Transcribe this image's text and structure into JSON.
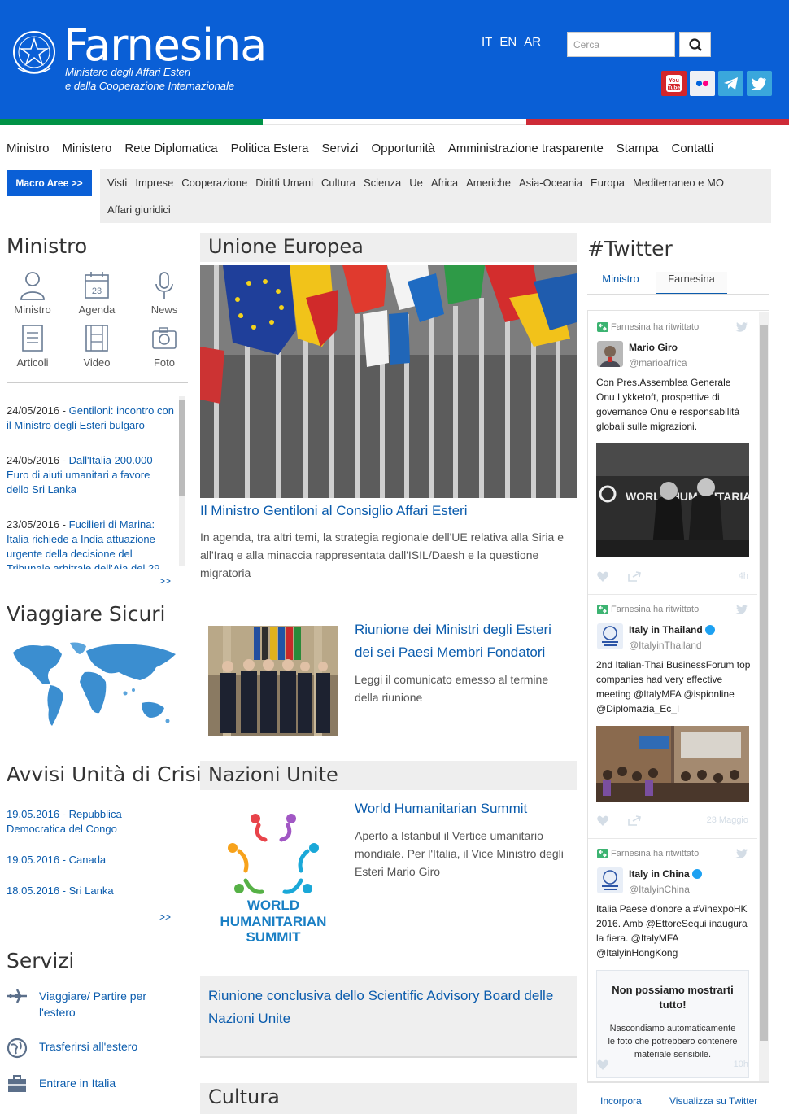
{
  "header": {
    "brand": "Farnesina",
    "subtitle_line1": "Ministero degli Affari Esteri",
    "subtitle_line2": "e della Cooperazione Internazionale",
    "langs": [
      "IT",
      "EN",
      "AR"
    ],
    "search_placeholder": "Cerca",
    "social": [
      "youtube-icon",
      "flickr-icon",
      "telegram-icon",
      "twitter-icon"
    ],
    "colors": {
      "brand_blue": "#0a5fd6",
      "flag_green": "#009246",
      "flag_white": "#ffffff",
      "flag_red": "#ce2b37"
    }
  },
  "nav": {
    "items": [
      "Ministro",
      "Ministero",
      "Rete Diplomatica",
      "Politica Estera",
      "Servizi",
      "Opportunità",
      "Amministrazione trasparente",
      "Stampa",
      "Contatti"
    ],
    "macro_label": "Macro Aree >>",
    "sub_items": [
      "Visti",
      "Imprese",
      "Cooperazione",
      "Diritti Umani",
      "Cultura",
      "Scienza",
      "Ue",
      "Africa",
      "Americhe",
      "Asia-Oceania",
      "Europa",
      "Mediterraneo e MO",
      "Affari giuridici"
    ]
  },
  "left": {
    "ministro_title": "Ministro",
    "icons": [
      {
        "label": "Ministro",
        "icon": "person-icon"
      },
      {
        "label": "Agenda",
        "icon": "calendar-icon",
        "day": "23"
      },
      {
        "label": "News",
        "icon": "microphone-icon"
      },
      {
        "label": "Articoli",
        "icon": "document-icon"
      },
      {
        "label": "Video",
        "icon": "film-icon"
      },
      {
        "label": "Foto",
        "icon": "camera-icon"
      }
    ],
    "news": [
      {
        "date": "24/05/2016 - ",
        "text": "Gentiloni: incontro con il Ministro degli Esteri bulgaro"
      },
      {
        "date": "24/05/2016 - ",
        "text": "Dall'Italia 200.000 Euro di aiuti umanitari a favore dello Sri Lanka"
      },
      {
        "date": "23/05/2016 - ",
        "text": "Fucilieri di Marina: Italia richiede a India attuazione urgente della decisione del Tribunale arbitrale dell'Aja del 29"
      }
    ],
    "more": ">>",
    "viaggiare_title": "Viaggiare Sicuri",
    "avvisi_title": "Avvisi Unità di Crisi",
    "avvisi": [
      {
        "date": "19.05.2016 - ",
        "text": "Repubblica Democratica del Congo"
      },
      {
        "date": "19.05.2016 - ",
        "text": "Canada"
      },
      {
        "date": "18.05.2016 - ",
        "text": "Sri Lanka"
      }
    ],
    "avvisi_more": ">>",
    "servizi_title": "Servizi",
    "servizi": [
      {
        "label": "Viaggiare/ Partire per l'estero",
        "icon": "plane-icon"
      },
      {
        "label": "Trasferirsi all'estero",
        "icon": "globe-icon"
      },
      {
        "label": "Entrare in Italia",
        "icon": "briefcase-icon"
      }
    ]
  },
  "center": {
    "ue_title": "Unione Europea",
    "ue_article_title": "Il Ministro Gentiloni al Consiglio Affari Esteri",
    "ue_article_text": "In agenda, tra altri temi, la strategia regionale dell'UE relativa alla Siria e all'Iraq e alla minaccia rappresentata dall'ISIL/Daesh e la questione migratoria",
    "riunione_title": "Riunione dei Ministri degli Esteri dei sei Paesi Membri Fondatori",
    "riunione_text": "Leggi il comunicato emesso al termine della riunione",
    "onu_title": "Nazioni Unite",
    "whs_title": "World Humanitarian Summit",
    "whs_text": "Aperto a Istanbul il Vertice umanitario mondiale. Per l'Italia, il Vice Ministro degli Esteri Mario Giro",
    "whs_logo": [
      "WORLD",
      "HUMANITARIAN",
      "SUMMIT"
    ],
    "sab_title": "Riunione conclusiva dello Scientific Advisory Board delle Nazioni Unite",
    "cultura_title": "Cultura"
  },
  "twitter": {
    "title": "#Twitter",
    "tabs": [
      "Ministro",
      "Farnesina"
    ],
    "retweet": "Farnesina ha ritwittato",
    "tweets": [
      {
        "name": "Mario Giro",
        "handle": "@marioafrica",
        "text": "Con Pres.Assemblea Generale Onu Lykketoft, prospettive di governance Onu e responsabilità globali sulle migrazioni.",
        "time": "4h",
        "img_text": "WORLD HUMANITARIAN"
      },
      {
        "name": "Italy in Thailand",
        "handle": "@ItalyinThailand",
        "text": "2nd Italian-Thai BusinessForum top companies had very effective meeting @ItalyMFA @ispionline @Diplomazia_Ec_I",
        "time": "23 Maggio"
      },
      {
        "name": "Italy in China",
        "handle": "@ItalyinChina",
        "text": "Italia Paese d'onore a #VinexpoHK 2016. Amb @EttoreSequi inaugura la fiera. @ItalyMFA @ItalyinHongKong",
        "time": "10h"
      }
    ],
    "sensitive_title": "Non possiamo mostrarti tutto!",
    "sensitive_text": "Nascondiamo automaticamente le foto che potrebbero contenere materiale sensibile.",
    "footer_embed": "Incorpora",
    "footer_view": "Visualizza su Twitter"
  }
}
